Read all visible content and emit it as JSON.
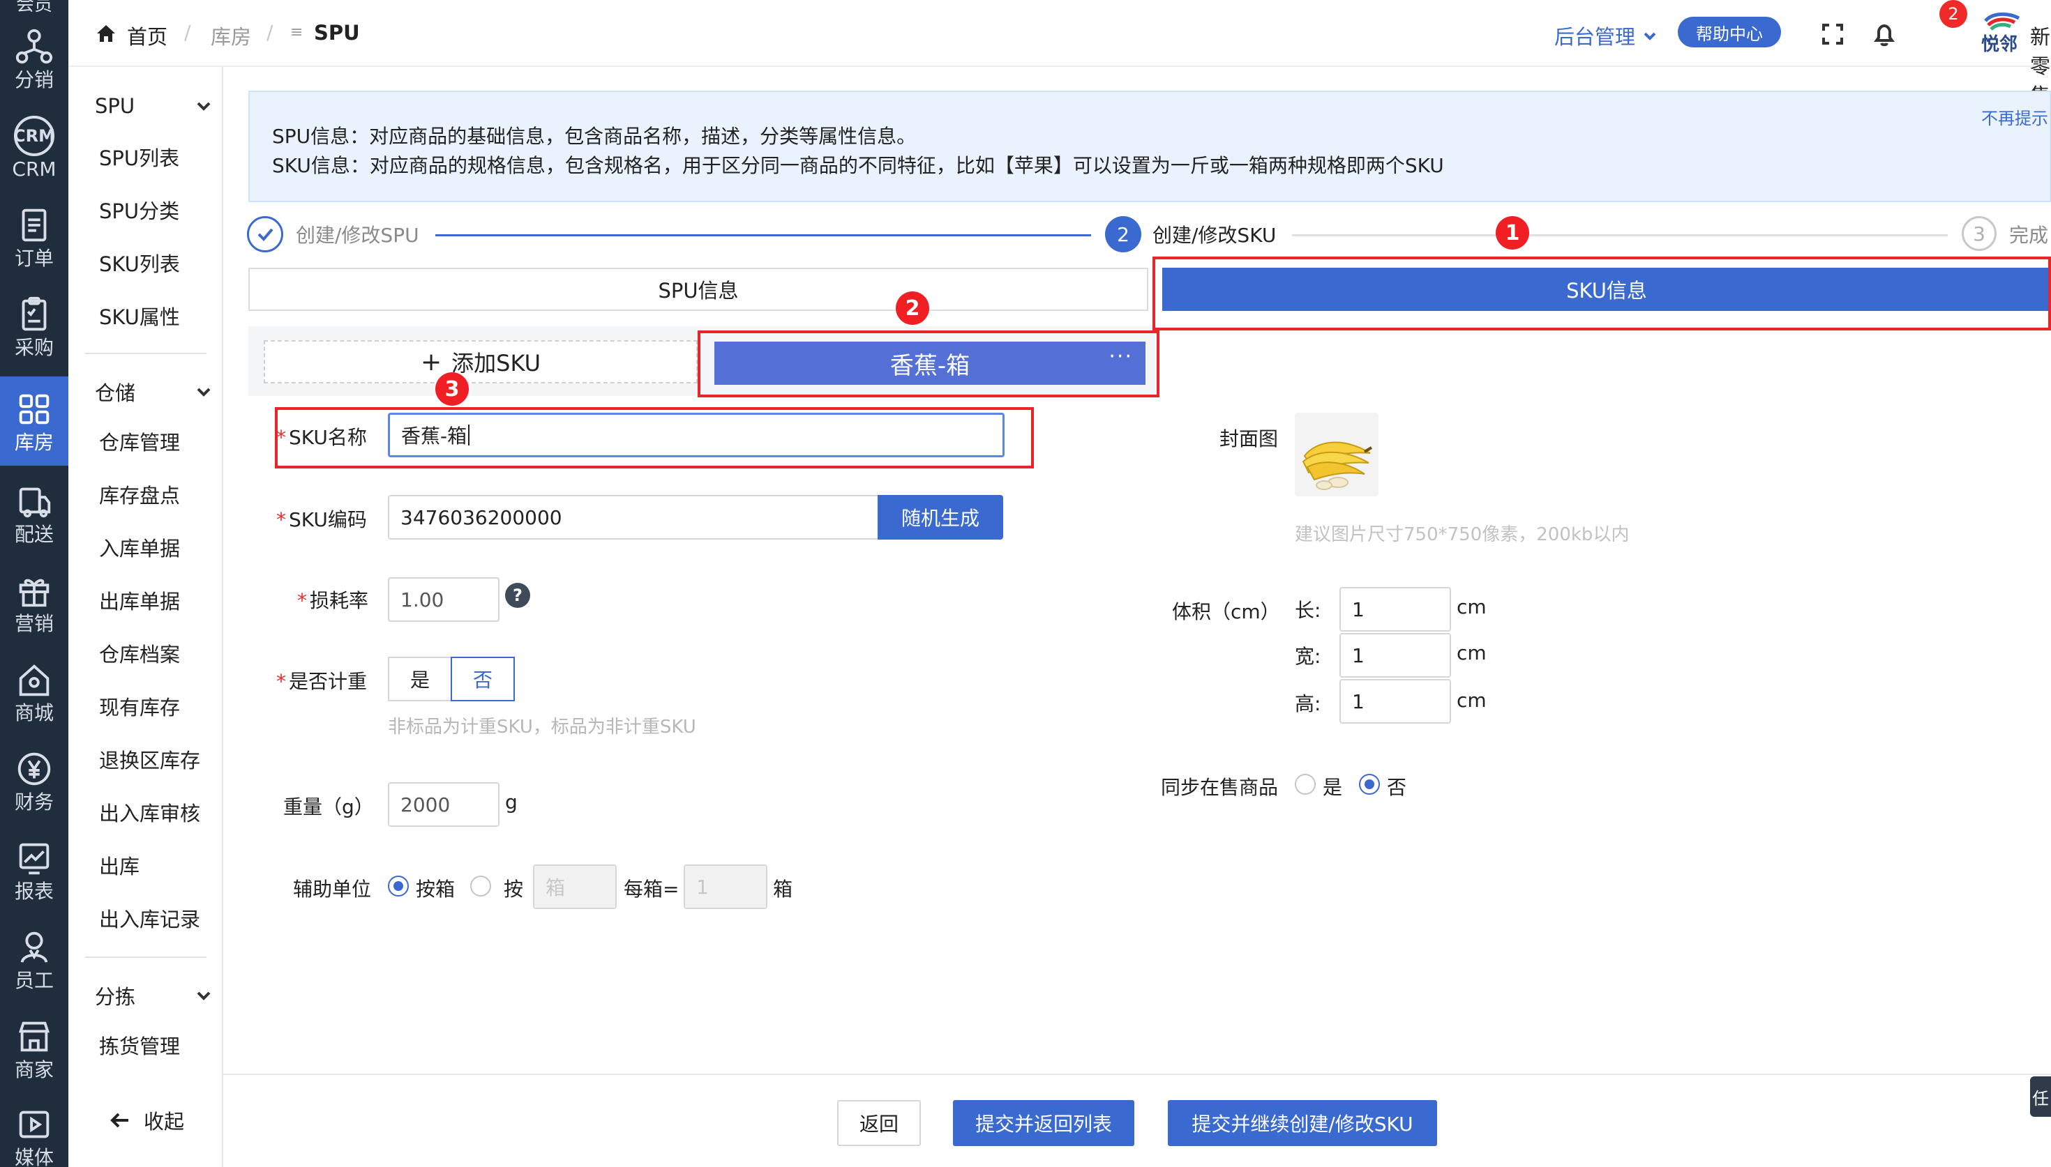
{
  "rail": {
    "top_partial": "会员",
    "items": [
      {
        "label": "分销",
        "icon": "distribution-icon"
      },
      {
        "label": "CRM",
        "icon": "crm-icon",
        "icon_text": "CRM"
      },
      {
        "label": "订单",
        "icon": "order-icon"
      },
      {
        "label": "采购",
        "icon": "purchase-icon"
      },
      {
        "label": "库房",
        "icon": "warehouse-icon",
        "active": true
      },
      {
        "label": "配送",
        "icon": "delivery-icon"
      },
      {
        "label": "营销",
        "icon": "gift-icon"
      },
      {
        "label": "商城",
        "icon": "home-icon"
      },
      {
        "label": "财务",
        "icon": "yen-icon"
      },
      {
        "label": "报表",
        "icon": "report-icon"
      },
      {
        "label": "员工",
        "icon": "staff-icon"
      },
      {
        "label": "商家",
        "icon": "store-icon"
      },
      {
        "label": "媒体",
        "icon": "media-icon"
      }
    ]
  },
  "submenu": {
    "groups": [
      {
        "title": "SPU",
        "items": [
          "SPU列表",
          "SPU分类",
          "SKU列表",
          "SKU属性"
        ]
      },
      {
        "title": "仓储",
        "items": [
          "仓库管理",
          "库存盘点",
          "入库单据",
          "出库单据",
          "仓库档案",
          "现有库存",
          "退换区库存",
          "出入库审核",
          "出库",
          "出入库记录"
        ]
      },
      {
        "title": "分拣",
        "items": [
          "拣货管理"
        ]
      }
    ],
    "collapse_label": "收起"
  },
  "header": {
    "breadcrumb": [
      "首页",
      "库房",
      "SPU"
    ],
    "breadcrumb_sep": "/",
    "list_glyph": "≡",
    "backend_label": "后台管理",
    "help_label": "帮助中心",
    "notification_count": "2",
    "logo_text": "悦邻",
    "shop_name": "新零售"
  },
  "notice": {
    "line1": "SPU信息：对应商品的基础信息，包含商品名称，描述，分类等属性信息。",
    "line2": "SKU信息：对应商品的规格信息，包含规格名，用于区分同一商品的不同特征，比如【苹果】可以设置为一斤或一箱两种规格即两个SKU",
    "dismiss": "不再提示"
  },
  "steps": [
    {
      "label": "创建/修改SPU",
      "state": "done"
    },
    {
      "num": "2",
      "label": "创建/修改SKU",
      "state": "active"
    },
    {
      "num": "3",
      "label": "完成",
      "state": "wait"
    }
  ],
  "tabs": {
    "spu": "SPU信息",
    "sku": "SKU信息"
  },
  "sku_bar": {
    "add_label": "添加SKU",
    "current_chip": "香蕉-箱",
    "chip_more": "···"
  },
  "annotations": [
    "1",
    "2",
    "3"
  ],
  "form": {
    "sku_name_label": "SKU名称",
    "sku_name_value": "香蕉-箱",
    "sku_code_label": "SKU编码",
    "sku_code_value": "3476036200000",
    "random_btn": "随机生成",
    "loss_label": "损耗率",
    "loss_value": "1.00",
    "weighed_label": "是否计重",
    "yes": "是",
    "no": "否",
    "weighed_hint": "非标品为计重SKU，标品为非计重SKU",
    "weight_label": "重量（g）",
    "weight_value": "2000",
    "weight_unit": "g",
    "aux_label": "辅助单位",
    "aux_by_box": "按箱",
    "aux_by": "按",
    "aux_unit_placeholder": "箱",
    "per_box": "每箱=",
    "per_box_placeholder": "1",
    "box_unit": "箱",
    "cover_label": "封面图",
    "cover_hint": "建议图片尺寸750*750像素，200kb以内",
    "volume_label": "体积（cm）",
    "len_label": "长:",
    "wid_label": "宽:",
    "hei_label": "高:",
    "len_value": "1",
    "wid_value": "1",
    "hei_value": "1",
    "cm": "cm",
    "sync_label": "同步在售商品",
    "sync_yes": "是",
    "sync_no": "否"
  },
  "footer": {
    "back": "返回",
    "submit_return": "提交并返回列表",
    "submit_continue": "提交并继续创建/修改SKU",
    "side_tab": "任"
  }
}
